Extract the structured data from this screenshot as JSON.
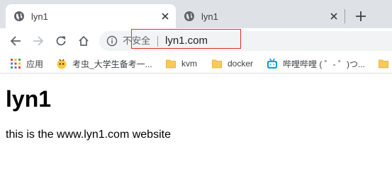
{
  "tabs": [
    {
      "title": "lyn1",
      "active": true
    },
    {
      "title": "lyn1",
      "active": false
    }
  ],
  "omnibox": {
    "security_text": "不安全",
    "url": "lyn1.com"
  },
  "bookmarks": [
    {
      "label": "应用",
      "icon": "apps-grid-icon"
    },
    {
      "label": "考虫_大学生备考一...",
      "icon": "kaochong-icon"
    },
    {
      "label": "kvm",
      "icon": "folder-icon"
    },
    {
      "label": "docker",
      "icon": "folder-icon"
    },
    {
      "label": "哔哩哔哩 ( ゜- ゜)つ...",
      "icon": "bilibili-icon"
    }
  ],
  "page": {
    "heading": "lyn1",
    "body": "this is the www.lyn1.com website"
  },
  "colors": {
    "tabstrip": "#dee1e6",
    "folder": "#f9ca5a",
    "highlight": "#d93025",
    "bilibili": "#00a1d6"
  }
}
